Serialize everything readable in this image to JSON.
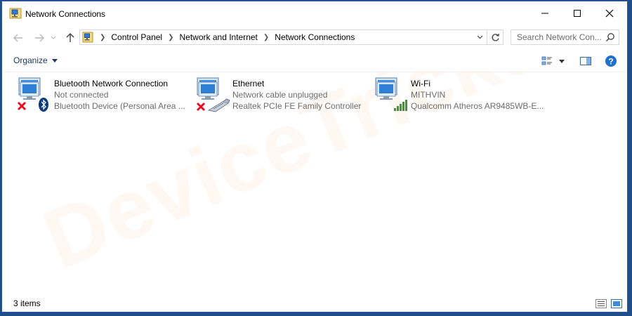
{
  "window": {
    "title": "Network Connections"
  },
  "navigation": {
    "breadcrumbs": [
      "Control Panel",
      "Network and Internet",
      "Network Connections"
    ],
    "search_placeholder": "Search Network Con..."
  },
  "toolbar": {
    "organize_label": "Organize"
  },
  "connections": [
    {
      "name": "Bluetooth Network Connection",
      "status": "Not connected",
      "device": "Bluetooth Device (Personal Area ...",
      "icon": "monitor-icon",
      "status_icon": "disconnected-x-icon",
      "adapter_icon": "bluetooth-icon"
    },
    {
      "name": "Ethernet",
      "status": "Network cable unplugged",
      "device": "Realtek PCIe FE Family Controller",
      "icon": "monitor-icon",
      "status_icon": "disconnected-x-icon",
      "adapter_icon": "ethernet-cable-icon"
    },
    {
      "name": "Wi-Fi",
      "status": "MITHVIN",
      "device": "Qualcomm Atheros AR9485WB-E...",
      "icon": "monitor-icon",
      "adapter_icon": "wifi-signal-icon"
    }
  ],
  "status_bar": {
    "item_count": "3 items"
  },
  "watermark_text": "DeviceTricks",
  "colors": {
    "accent": "#1e395b",
    "secondary_text": "#6d6d6d",
    "error_red": "#e81123",
    "bluetooth_blue": "#0a5fb4",
    "wifi_green": "#3a9a2d",
    "watermark": "#f07828"
  }
}
